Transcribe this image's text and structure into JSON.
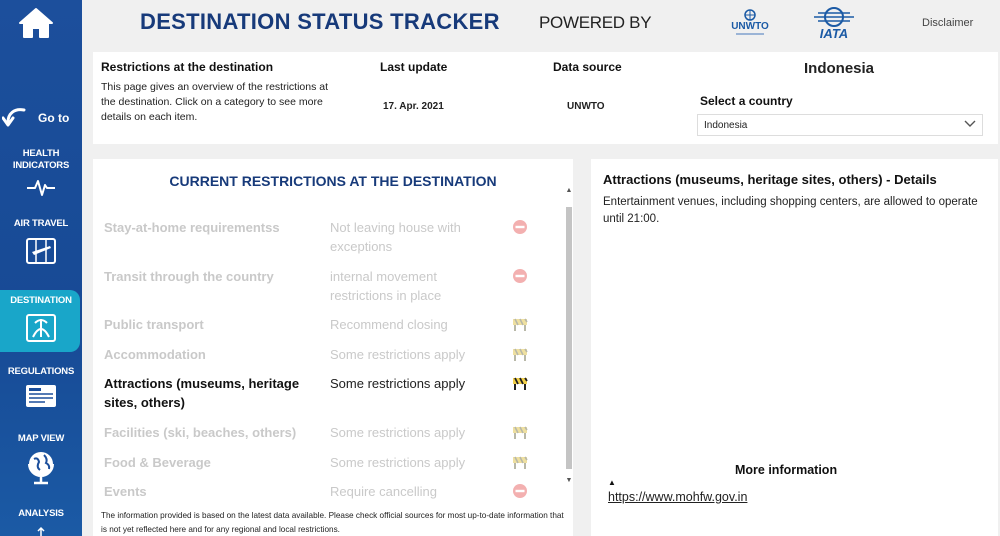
{
  "header": {
    "title": "DESTINATION STATUS TRACKER",
    "powered_by": "POWERED BY",
    "disclaimer": "Disclaimer",
    "logos": [
      "unwto-logo",
      "iata-logo"
    ]
  },
  "sidebar": {
    "home_icon": "home-icon",
    "goto_label": "Go to",
    "items": [
      {
        "label_lines": [
          "HEALTH",
          "INDICATORS"
        ],
        "icon": "pulse-icon",
        "active": false
      },
      {
        "label_lines": [
          "AIR TRAVEL"
        ],
        "icon": "airplane-map-icon",
        "active": false
      },
      {
        "label_lines": [
          "DESTINATION"
        ],
        "icon": "beach-icon",
        "active": true
      },
      {
        "label_lines": [
          "REGULATIONS"
        ],
        "icon": "document-icon",
        "active": false
      },
      {
        "label_lines": [
          "MAP VIEW"
        ],
        "icon": "globe-icon",
        "active": false
      },
      {
        "label_lines": [
          "ANALYSIS"
        ],
        "icon": "chart-icon",
        "active": false
      }
    ]
  },
  "info": {
    "section_title": "Restrictions at the destination",
    "description": "This page gives an overview of the restrictions at the destination. Click on a category to see more details on each item.",
    "last_update_label": "Last update",
    "last_update_value": "17. Apr. 2021",
    "data_source_label": "Data source",
    "data_source_value": "UNWTO",
    "country_title": "Indonesia",
    "select_label": "Select a country",
    "select_value": "Indonesia"
  },
  "restrictions": {
    "title": "CURRENT RESTRICTIONS AT THE DESTINATION",
    "rows": [
      {
        "category": "Stay-at-home requirementss",
        "status": "Not leaving house with exceptions",
        "icon": "no-entry-icon",
        "active": false
      },
      {
        "category": "Transit through the country",
        "status": "internal movement restrictions in place",
        "icon": "no-entry-icon",
        "active": false
      },
      {
        "category": "Public transport",
        "status": "Recommend closing",
        "icon": "barrier-icon",
        "active": false
      },
      {
        "category": "Accommodation",
        "status": "Some restrictions apply",
        "icon": "barrier-icon",
        "active": false
      },
      {
        "category": "Attractions (museums, heritage sites, others)",
        "status": "Some restrictions apply",
        "icon": "barrier-icon",
        "active": true
      },
      {
        "category": "Facilities (ski, beaches, others)",
        "status": "Some restrictions apply",
        "icon": "barrier-icon",
        "active": false
      },
      {
        "category": "Food & Beverage",
        "status": "Some restrictions apply",
        "icon": "barrier-icon",
        "active": false
      },
      {
        "category": "Events",
        "status": "Require cancelling",
        "icon": "no-entry-icon",
        "active": false
      }
    ],
    "footnote": "The information provided is based on the latest data available. Please check official sources for most up-to-date information that is not yet reflected here and for any regional and local restrictions."
  },
  "details": {
    "title": "Attractions (museums, heritage sites, others) - Details",
    "text": "Entertainment venues, including shopping centers, are allowed to operate until 21:00.",
    "more_info_label": "More information",
    "link": "https://www.mohfw.gov.in"
  },
  "colors": {
    "sidebar": "#1c4f9c",
    "active_nav": "#19a6c9",
    "title_blue": "#173a7a",
    "no_entry": "#f0a0a0",
    "barrier_yellow": "#f2d04a"
  }
}
